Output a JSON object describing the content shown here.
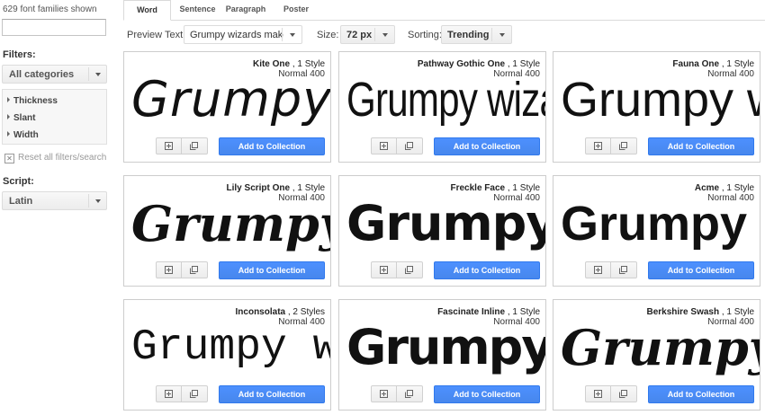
{
  "sidebar": {
    "count_text": "629 font families shown",
    "search_value": "",
    "filters_label": "Filters:",
    "category_value": "All categories",
    "filters": [
      "Thickness",
      "Slant",
      "Width"
    ],
    "reset_label": "Reset all filters/search",
    "script_label": "Script:",
    "script_value": "Latin"
  },
  "tabs": [
    "Word",
    "Sentence",
    "Paragraph",
    "Poster"
  ],
  "toolbar": {
    "preview_label": "Preview Text:",
    "preview_value": "Grumpy wizards make tox",
    "size_label": "Size:",
    "size_value": "72 px",
    "sorting_label": "Sorting:",
    "sorting_value": "Trending"
  },
  "cards": [
    {
      "name": "Kite One",
      "styles": " , 1 Style",
      "weight": "Normal 400",
      "sample": "Grumpy wizards",
      "add": "Add to Collection"
    },
    {
      "name": "Pathway Gothic One",
      "styles": " , 1 Style",
      "weight": "Normal 400",
      "sample": "Grumpy wizards",
      "add": "Add to Collection"
    },
    {
      "name": "Fauna One",
      "styles": " , 1 Style",
      "weight": "Normal 400",
      "sample": "Grumpy wizards",
      "add": "Add to Collection"
    },
    {
      "name": "Lily Script One",
      "styles": " , 1 Style",
      "weight": "Normal 400",
      "sample": "Grumpy wizards",
      "add": "Add to Collection"
    },
    {
      "name": "Freckle Face",
      "styles": " , 1 Style",
      "weight": "Normal 400",
      "sample": "Grumpy wizards",
      "add": "Add to Collection"
    },
    {
      "name": "Acme",
      "styles": " , 1 Style",
      "weight": "Normal 400",
      "sample": "Grumpy wizards",
      "add": "Add to Collection"
    },
    {
      "name": "Inconsolata",
      "styles": " , 2 Styles",
      "weight": "Normal 400",
      "sample": "Grumpy wizards",
      "add": "Add to Collection"
    },
    {
      "name": "Fascinate Inline",
      "styles": " , 1 Style",
      "weight": "Normal 400",
      "sample": "Grumpy wizards",
      "add": "Add to Collection"
    },
    {
      "name": "Berkshire Swash",
      "styles": " , 1 Style",
      "weight": "Normal 400",
      "sample": "Grumpy wizards",
      "add": "Add to Collection"
    }
  ],
  "colors": {
    "accent": "#4d90fe",
    "accent_border": "#3079ed"
  }
}
